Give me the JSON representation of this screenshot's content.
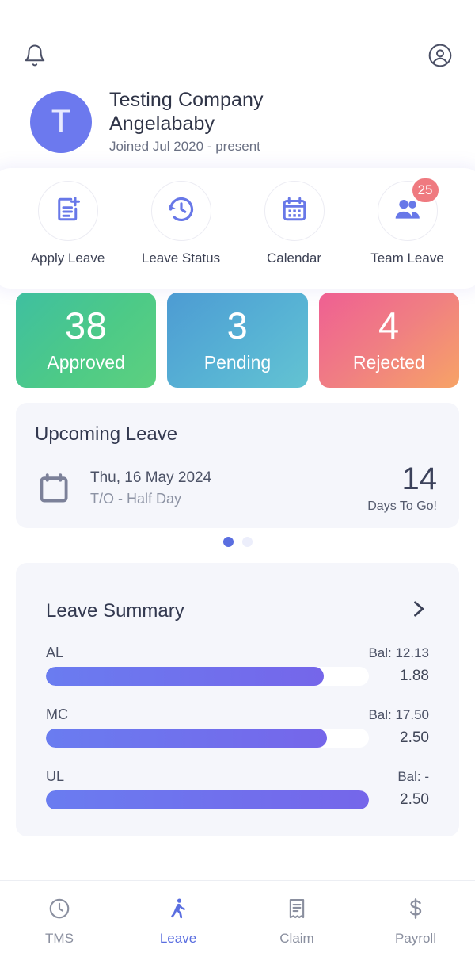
{
  "header": {
    "notification_icon": "bell-icon",
    "account_icon": "account-circle-icon"
  },
  "profile": {
    "avatar_initial": "T",
    "company_line1": "Testing Company",
    "company_line2": "Angelababy",
    "joined": "Joined Jul 2020 - present",
    "avatar_color": "#6c79ee"
  },
  "quick_actions": [
    {
      "label": "Apply Leave",
      "icon": "document-plus-icon"
    },
    {
      "label": "Leave Status",
      "icon": "history-clock-icon"
    },
    {
      "label": "Calendar",
      "icon": "calendar-icon"
    },
    {
      "label": "Team Leave",
      "icon": "people-icon",
      "badge": "25"
    }
  ],
  "stats": [
    {
      "value": "38",
      "label": "Approved",
      "color": "#4dca87"
    },
    {
      "value": "3",
      "label": "Pending",
      "color": "#57b2d4"
    },
    {
      "value": "4",
      "label": "Rejected",
      "color": "#f07f82"
    }
  ],
  "upcoming": {
    "title": "Upcoming Leave",
    "icon": "calendar-outline-icon",
    "date": "Thu, 16 May 2024",
    "type": "T/O - Half Day",
    "days": "14",
    "days_caption": "Days To Go!",
    "dots": {
      "total": 2,
      "active_index": 0
    }
  },
  "summary": {
    "title": "Leave Summary",
    "chevron_icon": "chevron-right-icon",
    "rows": [
      {
        "code": "AL",
        "balance": "Bal: 12.13",
        "value": "1.88",
        "percent": 86
      },
      {
        "code": "MC",
        "balance": "Bal: 17.50",
        "value": "2.50",
        "percent": 87
      },
      {
        "code": "UL",
        "balance": "Bal: -",
        "value": "2.50",
        "percent": 100
      }
    ]
  },
  "bottom_nav": {
    "active_color": "#5a6ee0",
    "inactive_color": "#8a8f9f",
    "items": [
      {
        "label": "TMS",
        "icon": "clock-icon",
        "active": false
      },
      {
        "label": "Leave",
        "icon": "walking-person-icon",
        "active": true
      },
      {
        "label": "Claim",
        "icon": "receipt-icon",
        "active": false
      },
      {
        "label": "Payroll",
        "icon": "dollar-icon",
        "active": false
      }
    ]
  }
}
